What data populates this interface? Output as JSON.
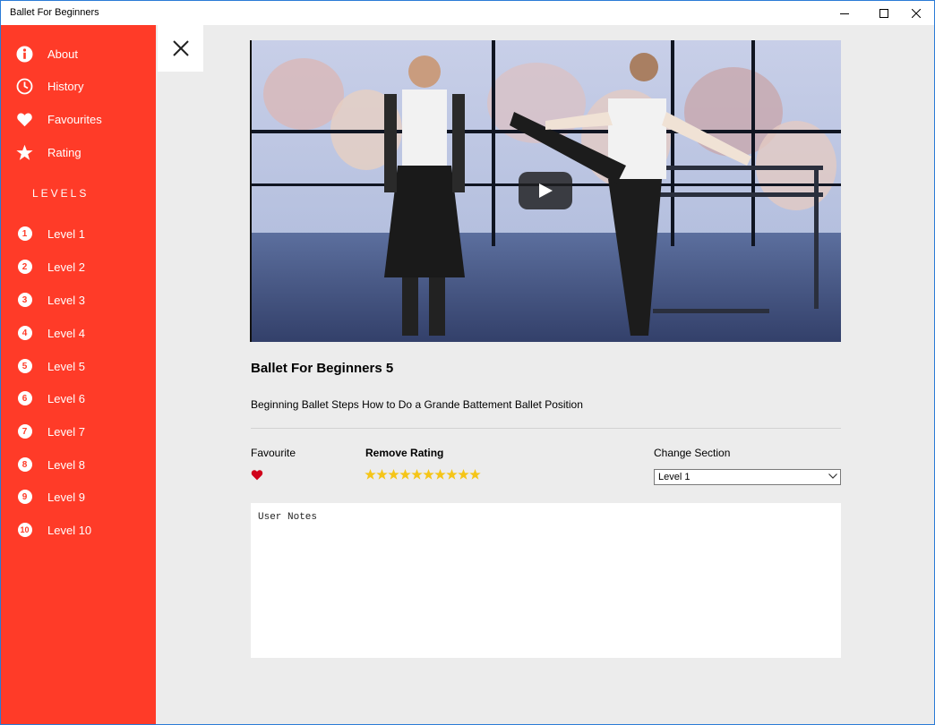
{
  "window": {
    "title": "Ballet For Beginners",
    "controls": [
      "minimize-icon",
      "maximize-icon",
      "close-icon"
    ]
  },
  "theme": {
    "accent": "#ff3b28",
    "star": "#f5c518",
    "heart": "#d0021b"
  },
  "sidebar": {
    "menu": [
      {
        "label": "About",
        "icon": "info-icon"
      },
      {
        "label": "History",
        "icon": "clock-icon"
      },
      {
        "label": "Favourites",
        "icon": "heart-icon"
      },
      {
        "label": "Rating",
        "icon": "star-icon"
      }
    ],
    "levels_header": "LEVELS",
    "levels": [
      {
        "num": "1",
        "label": "Level 1"
      },
      {
        "num": "2",
        "label": "Level 2"
      },
      {
        "num": "3",
        "label": "Level 3"
      },
      {
        "num": "4",
        "label": "Level 4"
      },
      {
        "num": "5",
        "label": "Level 5"
      },
      {
        "num": "6",
        "label": "Level 6"
      },
      {
        "num": "7",
        "label": "Level 7"
      },
      {
        "num": "8",
        "label": "Level 8"
      },
      {
        "num": "9",
        "label": "Level 9"
      },
      {
        "num": "10",
        "label": "Level 10"
      }
    ]
  },
  "detail": {
    "title": "Ballet For Beginners 5",
    "description": "Beginning Ballet Steps How to Do a Grande Battement Ballet Position",
    "favourite_label": "Favourite",
    "is_favourite": true,
    "rating_label": "Remove Rating",
    "rating": 10,
    "rating_max": 10,
    "section_label": "Change Section",
    "section_value": "Level 1",
    "notes_placeholder": "User Notes"
  }
}
